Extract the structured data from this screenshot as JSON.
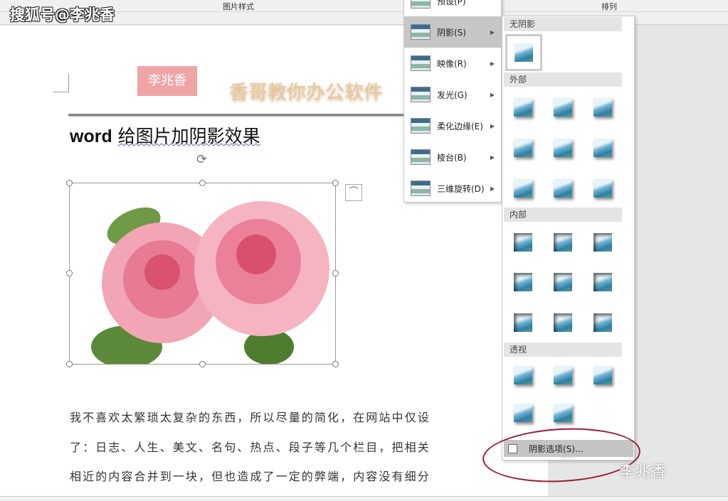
{
  "ribbon": {
    "group_picture_styles": "图片样式",
    "group_arrange": "排列"
  },
  "watermark_top": "搜狐号@李兆香",
  "doc": {
    "seal_text": "李兆香",
    "logo_text": "香哥教你办公软件",
    "title_word": "word",
    "title_rest": "给图片加阴影效果",
    "paragraph": [
      "我不喜欢太繁琐太复杂的东西，所以尽量的简化，在网站中仅设",
      "了：日志、人生、美文、名句、热点、段子等几个栏目，把相关",
      "相近的内容合并到一块，但也造成了一定的弊端，内容没有细分"
    ]
  },
  "effects_menu": {
    "items": [
      {
        "label": "预设(P)"
      },
      {
        "label": "阴影(S)",
        "selected": true
      },
      {
        "label": "映像(R)"
      },
      {
        "label": "发光(G)"
      },
      {
        "label": "柔化边缘(E)"
      },
      {
        "label": "棱台(B)"
      },
      {
        "label": "三维旋转(D)"
      }
    ]
  },
  "shadow_menu": {
    "sections": {
      "none": "无阴影",
      "outer": "外部",
      "inner": "内部",
      "perspective": "透视"
    },
    "options_label": "阴影选项(S)..."
  },
  "watermark_bottom": "李兆香",
  "colors": {
    "annotation": "#9b1b30",
    "menu_selected": "#c6c6c6"
  }
}
